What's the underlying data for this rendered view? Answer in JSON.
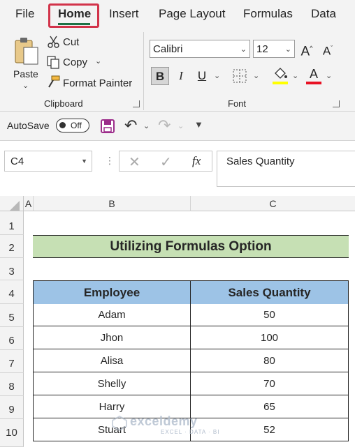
{
  "ribbon_tabs": [
    "File",
    "Home",
    "Insert",
    "Page Layout",
    "Formulas",
    "Data"
  ],
  "clipboard": {
    "paste_label": "Paste",
    "cut_label": "Cut",
    "copy_label": "Copy",
    "format_painter_label": "Format Painter",
    "group_label": "Clipboard"
  },
  "font": {
    "family": "Calibri",
    "size": "12",
    "group_label": "Font",
    "bold": "B",
    "italic": "I",
    "underline": "U",
    "font_color_letter": "A",
    "font_color": "#e81123",
    "fill_color": "#ffff00"
  },
  "qat": {
    "autosave_label": "AutoSave",
    "autosave_state": "Off"
  },
  "formula_bar": {
    "name_box": "C4",
    "fx": "fx",
    "content": "Sales Quantity"
  },
  "columns": [
    "A",
    "B",
    "C"
  ],
  "rows": [
    "1",
    "2",
    "3",
    "4",
    "5",
    "6",
    "7",
    "8",
    "9",
    "10"
  ],
  "sheet": {
    "title": "Utilizing Formulas Option",
    "headers": [
      "Employee",
      "Sales Quantity"
    ],
    "data": [
      [
        "Adam",
        "50"
      ],
      [
        "Jhon",
        "100"
      ],
      [
        "Alisa",
        "80"
      ],
      [
        "Shelly",
        "70"
      ],
      [
        "Harry",
        "65"
      ],
      [
        "Stuart",
        "52"
      ]
    ]
  },
  "watermark": {
    "name": "exceldemy",
    "tagline": "EXCEL · DATA · BI"
  }
}
